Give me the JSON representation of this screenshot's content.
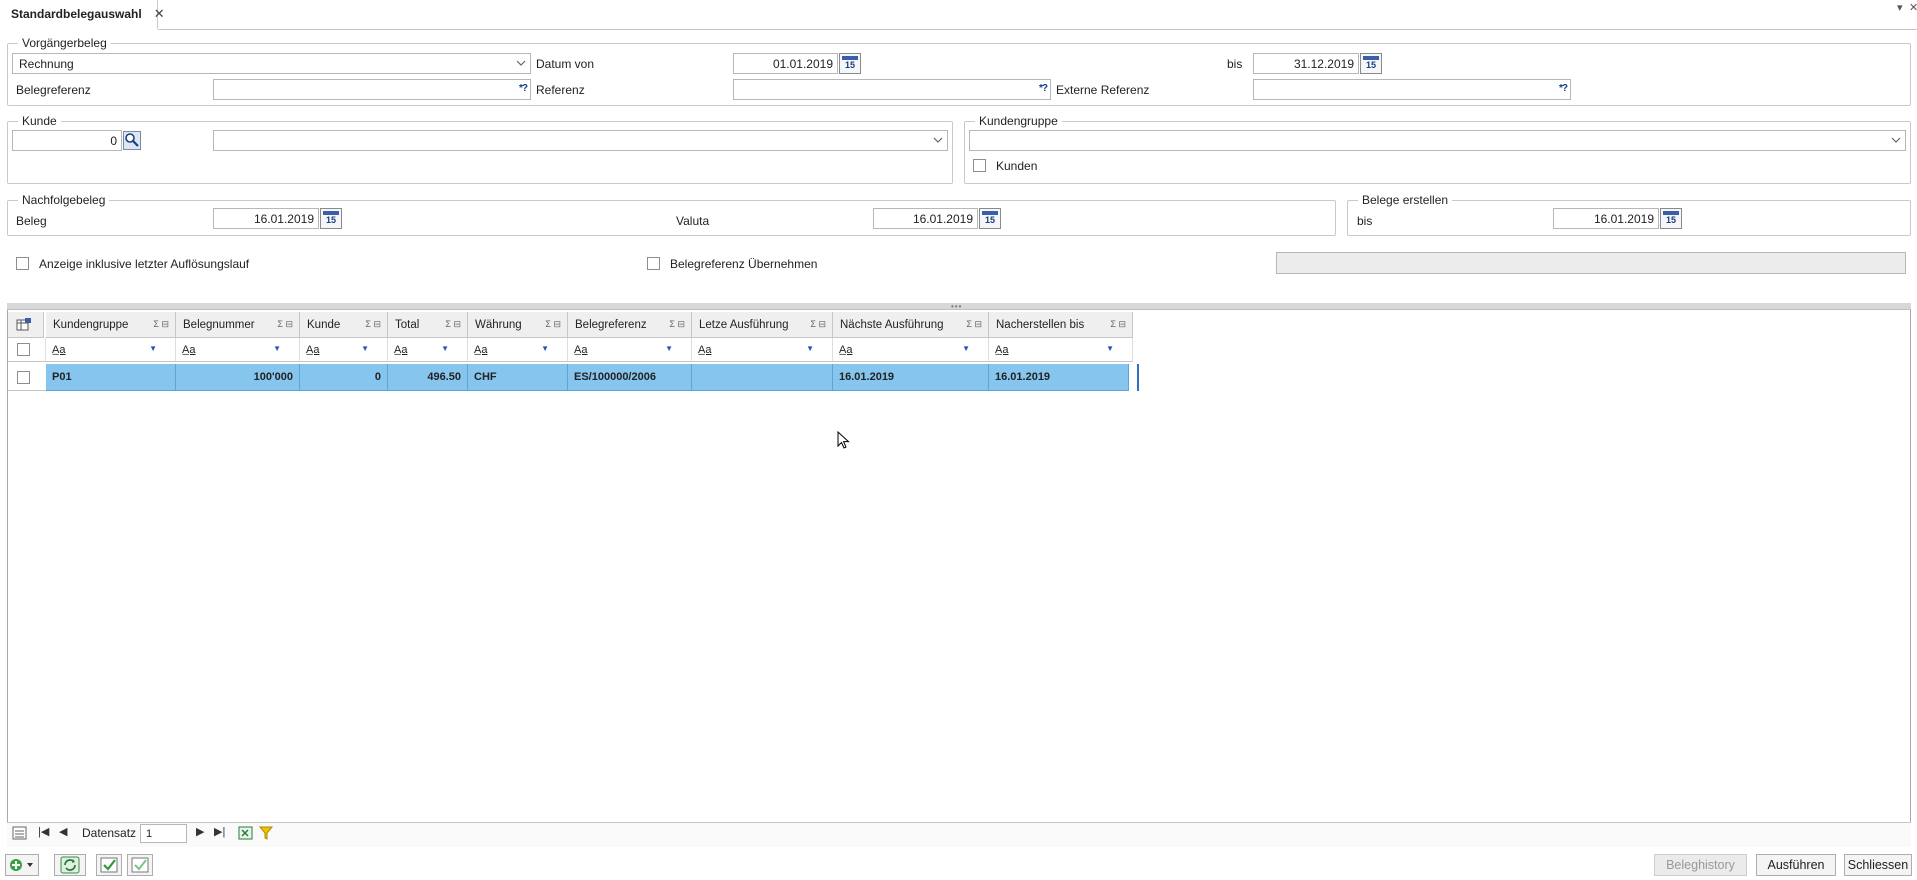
{
  "tab": {
    "title": "Standardbelegauswahl",
    "close": "✕"
  },
  "window_controls": {
    "dropdown": "▾",
    "close": "✕"
  },
  "vorgaenger": {
    "legend": "Vorgängerbeleg",
    "belegart_value": "Rechnung",
    "datum_von_label": "Datum von",
    "datum_von_value": "01.01.2019",
    "bis_label": "bis",
    "bis_value": "31.12.2019",
    "belegreferenz_label": "Belegreferenz",
    "referenz_label": "Referenz",
    "externe_referenz_label": "Externe Referenz",
    "wildcard_symbol": "*?"
  },
  "kunde": {
    "legend": "Kunde",
    "nummer_value": "0"
  },
  "kundengruppe": {
    "legend": "Kundengruppe",
    "kunden_label": "Kunden"
  },
  "nachfolge": {
    "legend": "Nachfolgebeleg",
    "beleg_label": "Beleg",
    "beleg_value": "16.01.2019",
    "valuta_label": "Valuta",
    "valuta_value": "16.01.2019"
  },
  "belege_erstellen": {
    "legend": "Belege erstellen",
    "bis_label": "bis",
    "bis_value": "16.01.2019"
  },
  "options": {
    "anzeige_label": "Anzeige inklusive letzter Auflösungslauf",
    "belegreferenz_label": "Belegreferenz Übernehmen"
  },
  "calendar_day": "15",
  "grid": {
    "columns": [
      "Kundengruppe",
      "Belegnummer",
      "Kunde",
      "Total",
      "Währung",
      "Belegreferenz",
      "Letze Ausführung",
      "Nächste Ausführung",
      "Nacherstellen bis"
    ],
    "header_ops": "Σ ⊟",
    "filter_op": "A̲a",
    "rows": [
      [
        "P01",
        "100'000",
        "0",
        "496.50",
        "CHF",
        "ES/100000/2006",
        "",
        "16.01.2019",
        "16.01.2019"
      ]
    ]
  },
  "navigator": {
    "label": "Datensatz",
    "value": "1"
  },
  "buttons": {
    "beleghistory": "Beleghistory",
    "ausfuehren": "Ausführen",
    "schliessen": "Schliessen"
  },
  "colors": {
    "selection": "#86c5ee",
    "accent": "#3a5fa8"
  }
}
